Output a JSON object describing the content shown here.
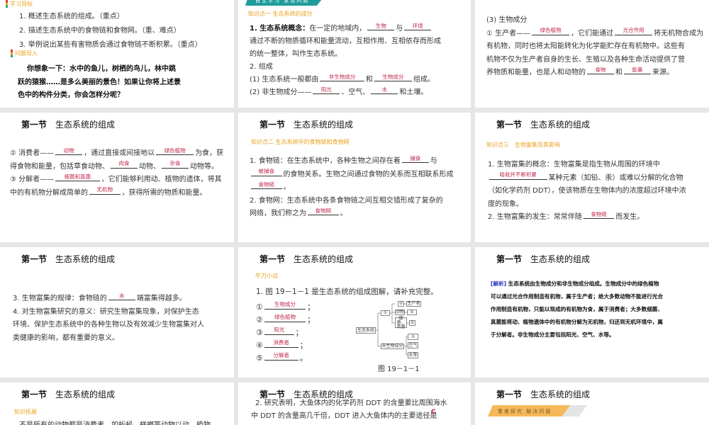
{
  "section_title": {
    "num": "第一节",
    "name": "生态系统的组成"
  },
  "s1": {
    "goals_label": "学习目标",
    "goals": [
      "1. 概述生态系统的组成。（重点）",
      "2. 描述生态系统中的食物链和食物网。（重、难点）",
      "3. 举例说出某些有害物质会通过食物链不断积累。（重点）"
    ],
    "intro_label": "问题导入",
    "intro": [
      "你想象一下：水中的鱼儿，树栖的鸟儿，林中跳",
      "跃的猿猴……是多么美丽的景色！如果让你将上述景",
      "色中的构件分类，你会怎样分呢？"
    ]
  },
  "s2": {
    "banner": "自主学习 发现问题",
    "knowledge": "知识点一 生态系统的成分",
    "lines": [
      [
        {
          "b": "1. 生态系统概念："
        },
        "在一定的地域内，",
        {
          "a": "生物"
        },
        "与",
        {
          "a": "环境"
        }
      ],
      [
        "通过不断的物质循环和能量流动，互相作用、互相依存而形成"
      ],
      [
        "的统一整体，叫作生态系统。"
      ],
      [
        "2. 组成"
      ],
      [
        "(1) 生态系统一般都由",
        {
          "a": "非生物成分"
        },
        "和",
        {
          "a": "生物成分"
        },
        "组成。"
      ],
      [
        "(2) 非生物成分——",
        {
          "a": "阳光"
        },
        "、空气、",
        {
          "a": "水"
        },
        "和土壤。"
      ]
    ]
  },
  "s3": {
    "lines": [
      [
        "(3) 生物成分"
      ],
      [
        "① 生产者——",
        {
          "a": "绿色植物"
        },
        "，它们能通过",
        {
          "a": "光合作用"
        },
        "将无机物合成为"
      ],
      [
        "有机物，同时也将太阳能转化为化学能贮存在有机物中。这些有"
      ],
      [
        "机物不仅为生产者自身的生长、生殖以及各种生命活动提供了营"
      ],
      [
        "养物质和能量，也是人和动物的",
        {
          "a": "食物"
        },
        "和",
        {
          "a": "能量"
        },
        "来源。"
      ]
    ]
  },
  "s4": {
    "lines": [
      [
        "② 消费者——",
        {
          "a": "动物"
        },
        "，通过直接或间接地以",
        {
          "a": "绿色植物"
        },
        "为食，获"
      ],
      [
        "得食物和能量，包括草食动物、",
        {
          "a": "肉食"
        },
        "动物、",
        {
          "a": "杂食"
        },
        "动物等。"
      ],
      [
        "③ 分解者——",
        {
          "a": "细菌和真菌"
        },
        "，它们能够利用动、植物的遗体，将其"
      ],
      [
        "中的有机物分解成简单的",
        {
          "a": "无机物"
        },
        "，获得所需的物质和能量。"
      ]
    ]
  },
  "s5": {
    "knowledge": "知识点二 生态系统中的食物链和食物网",
    "lines": [
      [
        "1. 食物链：在生态系统中，各种生物之间存在着",
        {
          "a": "捕食"
        },
        "与"
      ],
      [
        {
          "a": "被捕食"
        },
        "的食物关系。生物之间通过食物的关系而互相联系形成"
      ],
      [
        {
          "a": "食物链"
        },
        "。"
      ],
      [
        "2. 食物网：生态系统中各条食物链之间互相交错形成了复杂的"
      ],
      [
        "网络，我们称之为",
        {
          "a": "食物网"
        },
        "。"
      ]
    ]
  },
  "s6": {
    "knowledge": "知识点三　生物富集及其影响",
    "lines": [
      [
        "1. 生物富集的概念：生物富集是指生物从周围的环境中"
      ],
      [
        {
          "a": "吸收并不断积累"
        },
        "某种元素（如铅、汞）或难以分解的化合物"
      ],
      [
        "（如化学药剂 DDT），使该物质在生物体内的浓度超过环境中浓"
      ],
      [
        "度的现象。"
      ],
      [
        "2. 生物富集的发生：常常伴随",
        {
          "a": "食物链"
        },
        "而发生。"
      ]
    ]
  },
  "s7": {
    "lines": [
      [
        "3. 生物富集的规律：食物链的",
        {
          "a": "末"
        },
        "端富集得越多。"
      ],
      [
        "4. 对生物富集研究的意义：研究生物富集现象，对保护生态"
      ],
      [
        "环境、保护生态系统中的各种生物以及有效减少生物富集对人"
      ],
      [
        "类健康的影响，都有重要的意义。"
      ]
    ]
  },
  "s8": {
    "tag": "牛刀小试",
    "question": "1. 图 19－1－1 是生态系统的组成图解，请补充完整。",
    "answers": [
      [
        "①",
        {
          "a": "生物成分"
        },
        "；"
      ],
      [
        "②",
        {
          "a": "绿色植物"
        },
        "；"
      ],
      [
        "③",
        {
          "a": "阳光"
        },
        "；"
      ],
      [
        "④",
        {
          "a": "消费者"
        },
        "；"
      ],
      [
        "⑤",
        {
          "a": "分解者"
        },
        "。"
      ]
    ],
    "diagram": {
      "root": "生态系统",
      "bio": "①",
      "p": "②",
      "producer": "生产者",
      "animal": "动物",
      "c": "④",
      "fungi": "细菌、真菌",
      "d": "⑤",
      "abio": "非生物成分",
      "s": "③",
      "air": "空气",
      "water": "水等",
      "caption": "图 19－1－1"
    }
  },
  "s9": {
    "label": "[解析]",
    "lines": [
      "生态系统由生物成分和非生物成分组成。生物成分中的绿色植物",
      "可以通过光合作用制造有机物，属于生产者；绝大多数动物不能进行光合",
      "作用制造有机物，只能以现成的有机物为食，属于消费者；大多数细菌、",
      "真菌能将动、植物遗体中的有机物分解为无机物，归还到无机环境中，属",
      "于分解者。非生物成分主要包括阳光、空气、水等。"
    ]
  },
  "s10": {
    "tag": "知识拓展",
    "text": "不是所有的动物都是消费者，如蚯蚓、蜣螂等动物以动、植物"
  },
  "s11": {
    "lines": [
      "2. 研究表明，大鱼体内的化学药剂 DDT 的含量要比周围海水",
      "中 DDT 的含量高几千倍，DDT 进入大鱼体内的主要途径是",
      "(　　)"
    ],
    "answer": "C"
  },
  "s12": {
    "banner": "重难探究 解决问题"
  }
}
